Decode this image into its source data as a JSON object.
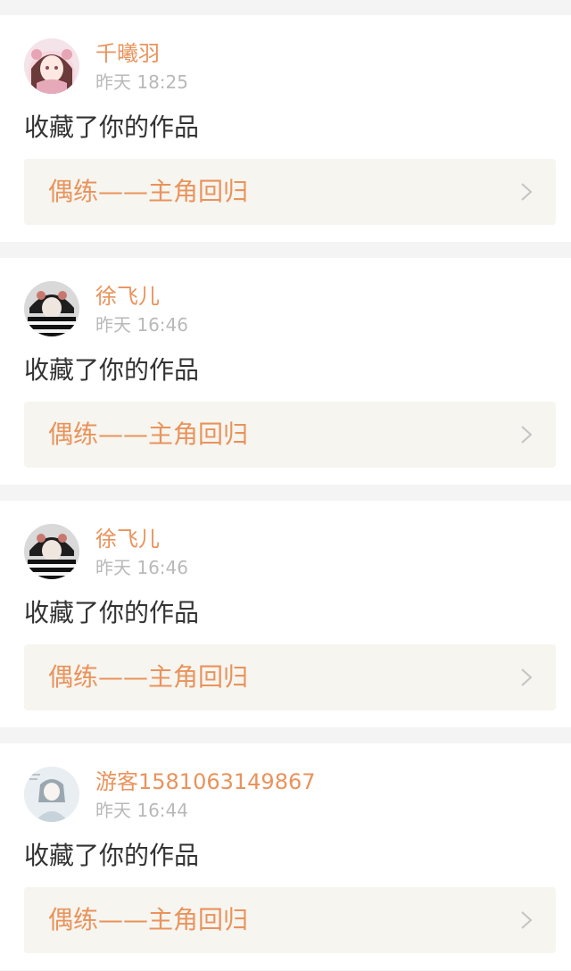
{
  "notifications": [
    {
      "user": "千曦羽",
      "time": "昨天 18:25",
      "action": "收藏了你的作品",
      "work_title": "偶练——主角回归",
      "avatar_icon": "anime-girl-avatar"
    },
    {
      "user": "徐飞儿",
      "time": "昨天 16:46",
      "action": "收藏了你的作品",
      "work_title": "偶练——主角回归",
      "avatar_icon": "striped-shirt-avatar"
    },
    {
      "user": "徐飞儿",
      "time": "昨天 16:46",
      "action": "收藏了你的作品",
      "work_title": "偶练——主角回归",
      "avatar_icon": "striped-shirt-avatar"
    },
    {
      "user": "游客1581063149867",
      "time": "昨天 16:44",
      "action": "收藏了你的作品",
      "work_title": "偶练——主角回归",
      "avatar_icon": "sketch-portrait-avatar"
    }
  ],
  "colors": {
    "accent": "#e9935c",
    "page_background": "#f5f4f4",
    "link_background": "#f6f5ef",
    "secondary_text": "#b9b9b9",
    "primary_text": "#333333"
  }
}
